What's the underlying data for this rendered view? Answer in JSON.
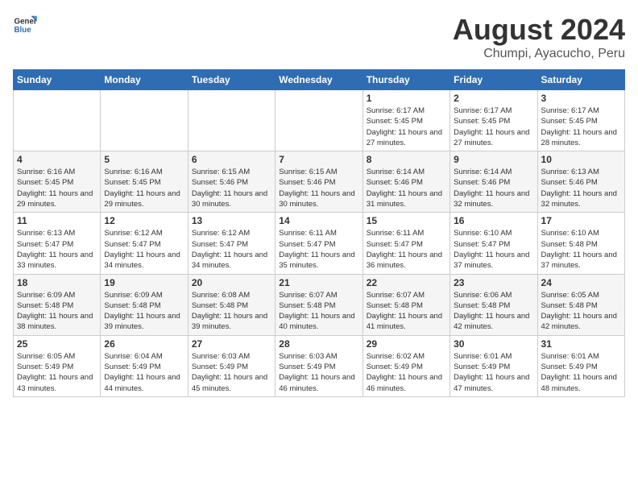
{
  "header": {
    "logo_general": "General",
    "logo_blue": "Blue",
    "month_year": "August 2024",
    "location": "Chumpi, Ayacucho, Peru"
  },
  "weekdays": [
    "Sunday",
    "Monday",
    "Tuesday",
    "Wednesday",
    "Thursday",
    "Friday",
    "Saturday"
  ],
  "weeks": [
    [
      {
        "day": "",
        "detail": ""
      },
      {
        "day": "",
        "detail": ""
      },
      {
        "day": "",
        "detail": ""
      },
      {
        "day": "",
        "detail": ""
      },
      {
        "day": "1",
        "detail": "Sunrise: 6:17 AM\nSunset: 5:45 PM\nDaylight: 11 hours and 27 minutes."
      },
      {
        "day": "2",
        "detail": "Sunrise: 6:17 AM\nSunset: 5:45 PM\nDaylight: 11 hours and 27 minutes."
      },
      {
        "day": "3",
        "detail": "Sunrise: 6:17 AM\nSunset: 5:45 PM\nDaylight: 11 hours and 28 minutes."
      }
    ],
    [
      {
        "day": "4",
        "detail": "Sunrise: 6:16 AM\nSunset: 5:45 PM\nDaylight: 11 hours and 29 minutes."
      },
      {
        "day": "5",
        "detail": "Sunrise: 6:16 AM\nSunset: 5:45 PM\nDaylight: 11 hours and 29 minutes."
      },
      {
        "day": "6",
        "detail": "Sunrise: 6:15 AM\nSunset: 5:46 PM\nDaylight: 11 hours and 30 minutes."
      },
      {
        "day": "7",
        "detail": "Sunrise: 6:15 AM\nSunset: 5:46 PM\nDaylight: 11 hours and 30 minutes."
      },
      {
        "day": "8",
        "detail": "Sunrise: 6:14 AM\nSunset: 5:46 PM\nDaylight: 11 hours and 31 minutes."
      },
      {
        "day": "9",
        "detail": "Sunrise: 6:14 AM\nSunset: 5:46 PM\nDaylight: 11 hours and 32 minutes."
      },
      {
        "day": "10",
        "detail": "Sunrise: 6:13 AM\nSunset: 5:46 PM\nDaylight: 11 hours and 32 minutes."
      }
    ],
    [
      {
        "day": "11",
        "detail": "Sunrise: 6:13 AM\nSunset: 5:47 PM\nDaylight: 11 hours and 33 minutes."
      },
      {
        "day": "12",
        "detail": "Sunrise: 6:12 AM\nSunset: 5:47 PM\nDaylight: 11 hours and 34 minutes."
      },
      {
        "day": "13",
        "detail": "Sunrise: 6:12 AM\nSunset: 5:47 PM\nDaylight: 11 hours and 34 minutes."
      },
      {
        "day": "14",
        "detail": "Sunrise: 6:11 AM\nSunset: 5:47 PM\nDaylight: 11 hours and 35 minutes."
      },
      {
        "day": "15",
        "detail": "Sunrise: 6:11 AM\nSunset: 5:47 PM\nDaylight: 11 hours and 36 minutes."
      },
      {
        "day": "16",
        "detail": "Sunrise: 6:10 AM\nSunset: 5:47 PM\nDaylight: 11 hours and 37 minutes."
      },
      {
        "day": "17",
        "detail": "Sunrise: 6:10 AM\nSunset: 5:48 PM\nDaylight: 11 hours and 37 minutes."
      }
    ],
    [
      {
        "day": "18",
        "detail": "Sunrise: 6:09 AM\nSunset: 5:48 PM\nDaylight: 11 hours and 38 minutes."
      },
      {
        "day": "19",
        "detail": "Sunrise: 6:09 AM\nSunset: 5:48 PM\nDaylight: 11 hours and 39 minutes."
      },
      {
        "day": "20",
        "detail": "Sunrise: 6:08 AM\nSunset: 5:48 PM\nDaylight: 11 hours and 39 minutes."
      },
      {
        "day": "21",
        "detail": "Sunrise: 6:07 AM\nSunset: 5:48 PM\nDaylight: 11 hours and 40 minutes."
      },
      {
        "day": "22",
        "detail": "Sunrise: 6:07 AM\nSunset: 5:48 PM\nDaylight: 11 hours and 41 minutes."
      },
      {
        "day": "23",
        "detail": "Sunrise: 6:06 AM\nSunset: 5:48 PM\nDaylight: 11 hours and 42 minutes."
      },
      {
        "day": "24",
        "detail": "Sunrise: 6:05 AM\nSunset: 5:48 PM\nDaylight: 11 hours and 42 minutes."
      }
    ],
    [
      {
        "day": "25",
        "detail": "Sunrise: 6:05 AM\nSunset: 5:49 PM\nDaylight: 11 hours and 43 minutes."
      },
      {
        "day": "26",
        "detail": "Sunrise: 6:04 AM\nSunset: 5:49 PM\nDaylight: 11 hours and 44 minutes."
      },
      {
        "day": "27",
        "detail": "Sunrise: 6:03 AM\nSunset: 5:49 PM\nDaylight: 11 hours and 45 minutes."
      },
      {
        "day": "28",
        "detail": "Sunrise: 6:03 AM\nSunset: 5:49 PM\nDaylight: 11 hours and 46 minutes."
      },
      {
        "day": "29",
        "detail": "Sunrise: 6:02 AM\nSunset: 5:49 PM\nDaylight: 11 hours and 46 minutes."
      },
      {
        "day": "30",
        "detail": "Sunrise: 6:01 AM\nSunset: 5:49 PM\nDaylight: 11 hours and 47 minutes."
      },
      {
        "day": "31",
        "detail": "Sunrise: 6:01 AM\nSunset: 5:49 PM\nDaylight: 11 hours and 48 minutes."
      }
    ]
  ]
}
